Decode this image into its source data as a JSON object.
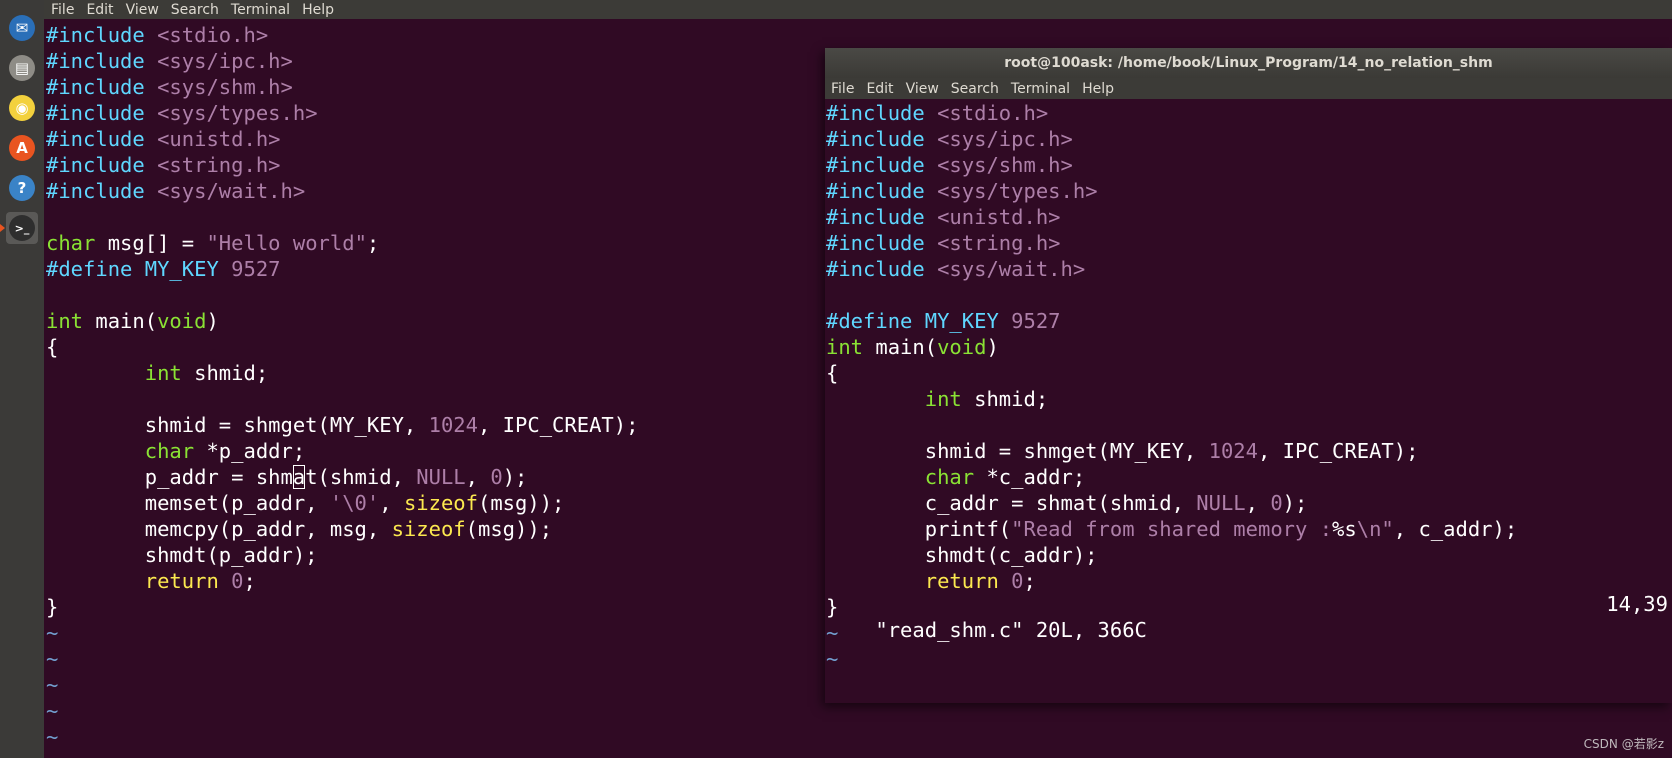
{
  "launcher": {
    "items": [
      {
        "name": "thunderbird-icon",
        "color": "#2a6fb8",
        "glyph": "✉"
      },
      {
        "name": "files-icon",
        "color": "#8e8c86",
        "glyph": "▤"
      },
      {
        "name": "rhythmbox-icon",
        "color": "#f3d13d",
        "glyph": "◉"
      },
      {
        "name": "software-center-icon",
        "color": "#e95420",
        "glyph": "A"
      },
      {
        "name": "help-icon",
        "color": "#3a83c7",
        "glyph": "?"
      },
      {
        "name": "terminal-icon",
        "color": "#2e2e2e",
        "glyph": ">_"
      }
    ]
  },
  "left_terminal": {
    "menu": [
      "File",
      "Edit",
      "View",
      "Search",
      "Terminal",
      "Help"
    ]
  },
  "right_terminal": {
    "title": "root@100ask: /home/book/Linux_Program/14_no_relation_shm",
    "menu": [
      "File",
      "Edit",
      "View",
      "Search",
      "Terminal",
      "Help"
    ],
    "status_file": "\"read_shm.c\" 20L, 366C",
    "status_pos": "14,39"
  },
  "left_code": [
    [
      [
        "pre",
        "#include"
      ],
      [
        "txt",
        " "
      ],
      [
        "str",
        "<stdio.h>"
      ]
    ],
    [
      [
        "pre",
        "#include"
      ],
      [
        "txt",
        " "
      ],
      [
        "str",
        "<sys/ipc.h>"
      ]
    ],
    [
      [
        "pre",
        "#include"
      ],
      [
        "txt",
        " "
      ],
      [
        "str",
        "<sys/shm.h>"
      ]
    ],
    [
      [
        "pre",
        "#include"
      ],
      [
        "txt",
        " "
      ],
      [
        "str",
        "<sys/types.h>"
      ]
    ],
    [
      [
        "pre",
        "#include"
      ],
      [
        "txt",
        " "
      ],
      [
        "str",
        "<unistd.h>"
      ]
    ],
    [
      [
        "pre",
        "#include"
      ],
      [
        "txt",
        " "
      ],
      [
        "str",
        "<string.h>"
      ]
    ],
    [
      [
        "pre",
        "#include"
      ],
      [
        "txt",
        " "
      ],
      [
        "str",
        "<sys/wait.h>"
      ]
    ],
    [],
    [
      [
        "type",
        "char"
      ],
      [
        "txt",
        " msg[] = "
      ],
      [
        "str",
        "\"Hello world\""
      ],
      [
        "txt",
        ";"
      ]
    ],
    [
      [
        "pre",
        "#define"
      ],
      [
        "txt",
        " "
      ],
      [
        "pre",
        "MY_KEY"
      ],
      [
        "txt",
        " "
      ],
      [
        "str",
        "9527"
      ]
    ],
    [],
    [
      [
        "type",
        "int"
      ],
      [
        "txt",
        " main("
      ],
      [
        "type",
        "void"
      ],
      [
        "txt",
        ")"
      ]
    ],
    [
      [
        "txt",
        "{"
      ]
    ],
    [
      [
        "txt",
        "        "
      ],
      [
        "type",
        "int"
      ],
      [
        "txt",
        " shmid;"
      ]
    ],
    [],
    [
      [
        "txt",
        "        shmid = shmget(MY_KEY, "
      ],
      [
        "str",
        "1024"
      ],
      [
        "txt",
        ", IPC_CREAT);"
      ]
    ],
    [
      [
        "txt",
        "        "
      ],
      [
        "type",
        "char"
      ],
      [
        "txt",
        " *p_addr;"
      ]
    ],
    [
      [
        "txt",
        "        p_addr = shm"
      ],
      [
        "cur",
        "a"
      ],
      [
        "txt",
        "t(shmid, "
      ],
      [
        "str",
        "NULL"
      ],
      [
        "txt",
        ", "
      ],
      [
        "str",
        "0"
      ],
      [
        "txt",
        ");"
      ]
    ],
    [
      [
        "txt",
        "        memset(p_addr, "
      ],
      [
        "str",
        "'\\0'"
      ],
      [
        "txt",
        ", "
      ],
      [
        "kw",
        "sizeof"
      ],
      [
        "txt",
        "(msg));"
      ]
    ],
    [
      [
        "txt",
        "        memcpy(p_addr, msg, "
      ],
      [
        "kw",
        "sizeof"
      ],
      [
        "txt",
        "(msg));"
      ]
    ],
    [
      [
        "txt",
        "        shmdt(p_addr);"
      ]
    ],
    [
      [
        "txt",
        "        "
      ],
      [
        "kw",
        "return"
      ],
      [
        "txt",
        " "
      ],
      [
        "str",
        "0"
      ],
      [
        "txt",
        ";"
      ]
    ],
    [
      [
        "txt",
        "}"
      ]
    ],
    [
      [
        "tilde",
        "~"
      ]
    ],
    [
      [
        "tilde",
        "~"
      ]
    ],
    [
      [
        "tilde",
        "~"
      ]
    ],
    [
      [
        "tilde",
        "~"
      ]
    ],
    [
      [
        "tilde",
        "~"
      ]
    ]
  ],
  "right_code": [
    [
      [
        "pre",
        "#include"
      ],
      [
        "txt",
        " "
      ],
      [
        "str",
        "<stdio.h>"
      ]
    ],
    [
      [
        "pre",
        "#include"
      ],
      [
        "txt",
        " "
      ],
      [
        "str",
        "<sys/ipc.h>"
      ]
    ],
    [
      [
        "pre",
        "#include"
      ],
      [
        "txt",
        " "
      ],
      [
        "str",
        "<sys/shm.h>"
      ]
    ],
    [
      [
        "pre",
        "#include"
      ],
      [
        "txt",
        " "
      ],
      [
        "str",
        "<sys/types.h>"
      ]
    ],
    [
      [
        "pre",
        "#include"
      ],
      [
        "txt",
        " "
      ],
      [
        "str",
        "<unistd.h>"
      ]
    ],
    [
      [
        "pre",
        "#include"
      ],
      [
        "txt",
        " "
      ],
      [
        "str",
        "<string.h>"
      ]
    ],
    [
      [
        "pre",
        "#include"
      ],
      [
        "txt",
        " "
      ],
      [
        "str",
        "<sys/wait.h>"
      ]
    ],
    [],
    [
      [
        "pre",
        "#define"
      ],
      [
        "txt",
        " "
      ],
      [
        "pre",
        "MY_KEY"
      ],
      [
        "txt",
        " "
      ],
      [
        "str",
        "9527"
      ]
    ],
    [
      [
        "type",
        "int"
      ],
      [
        "txt",
        " main("
      ],
      [
        "type",
        "void"
      ],
      [
        "txt",
        ")"
      ]
    ],
    [
      [
        "txt",
        "{"
      ]
    ],
    [
      [
        "txt",
        "        "
      ],
      [
        "type",
        "int"
      ],
      [
        "txt",
        " shmid;"
      ]
    ],
    [],
    [
      [
        "txt",
        "        shmid = shmget(MY_KEY, "
      ],
      [
        "str",
        "1024"
      ],
      [
        "txt",
        ", IPC_CREAT);"
      ]
    ],
    [
      [
        "txt",
        "        "
      ],
      [
        "type",
        "char"
      ],
      [
        "txt",
        " *c_addr;"
      ]
    ],
    [
      [
        "txt",
        "        c_addr = shmat(shmid, "
      ],
      [
        "str",
        "NULL"
      ],
      [
        "txt",
        ", "
      ],
      [
        "str",
        "0"
      ],
      [
        "txt",
        ");"
      ]
    ],
    [
      [
        "txt",
        "        printf("
      ],
      [
        "str",
        "\"Read from shared memory :"
      ],
      [
        "txt",
        "%s"
      ],
      [
        "str",
        "\\n\""
      ],
      [
        "txt",
        ", c_addr);"
      ]
    ],
    [
      [
        "txt",
        "        shmdt(c_addr);"
      ]
    ],
    [
      [
        "txt",
        "        "
      ],
      [
        "kw",
        "return"
      ],
      [
        "txt",
        " "
      ],
      [
        "str",
        "0"
      ],
      [
        "txt",
        ";"
      ]
    ],
    [
      [
        "txt",
        "}"
      ]
    ],
    [
      [
        "tilde",
        "~"
      ]
    ],
    [
      [
        "tilde",
        "~"
      ]
    ]
  ],
  "watermark": "CSDN @若影z"
}
